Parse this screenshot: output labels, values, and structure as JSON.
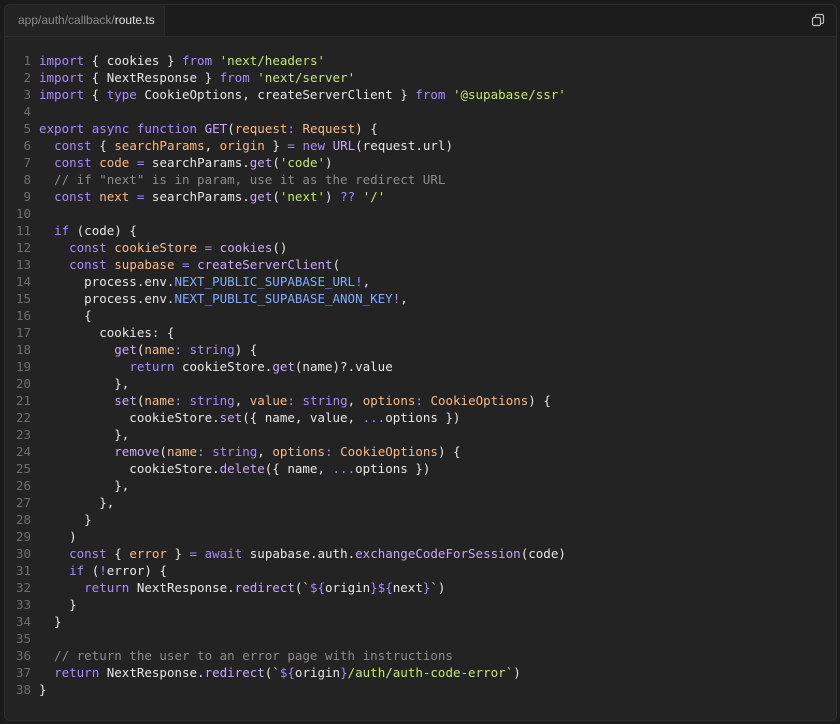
{
  "tab": {
    "path_prefix": "app/auth/callback/",
    "file_name": "route.ts"
  },
  "icons": {
    "copy": "copy-icon"
  },
  "colors": {
    "background": "#232323",
    "keyword": "#a78bfa",
    "string": "#c5e478",
    "comment": "#8b8b8b",
    "function": "#c7a8f7",
    "parameter": "#f8b886",
    "constant": "#82aaff",
    "line_number": "#6e6e6e"
  },
  "code_lines": [
    [
      [
        "keyword",
        "import"
      ],
      [
        "plain",
        " { cookies } "
      ],
      [
        "keyword",
        "from"
      ],
      [
        "plain",
        " "
      ],
      [
        "string",
        "'next/headers'"
      ]
    ],
    [
      [
        "keyword",
        "import"
      ],
      [
        "plain",
        " { NextResponse } "
      ],
      [
        "keyword",
        "from"
      ],
      [
        "plain",
        " "
      ],
      [
        "string",
        "'next/server'"
      ]
    ],
    [
      [
        "keyword",
        "import"
      ],
      [
        "plain",
        " { "
      ],
      [
        "keyword",
        "type"
      ],
      [
        "plain",
        " CookieOptions, createServerClient } "
      ],
      [
        "keyword",
        "from"
      ],
      [
        "plain",
        " "
      ],
      [
        "string",
        "'@supabase/ssr'"
      ]
    ],
    [],
    [
      [
        "keyword",
        "export"
      ],
      [
        "plain",
        " "
      ],
      [
        "keyword",
        "async"
      ],
      [
        "plain",
        " "
      ],
      [
        "keyword",
        "function"
      ],
      [
        "plain",
        " "
      ],
      [
        "func",
        "GET"
      ],
      [
        "plain",
        "("
      ],
      [
        "param",
        "request"
      ],
      [
        "keyword",
        ":"
      ],
      [
        "plain",
        " "
      ],
      [
        "type",
        "Request"
      ],
      [
        "plain",
        ") {"
      ]
    ],
    [
      [
        "plain",
        "  "
      ],
      [
        "keyword",
        "const"
      ],
      [
        "plain",
        " { "
      ],
      [
        "param",
        "searchParams"
      ],
      [
        "plain",
        ", "
      ],
      [
        "param",
        "origin"
      ],
      [
        "plain",
        " } "
      ],
      [
        "keyword",
        "="
      ],
      [
        "plain",
        " "
      ],
      [
        "keyword",
        "new"
      ],
      [
        "plain",
        " "
      ],
      [
        "func",
        "URL"
      ],
      [
        "plain",
        "(request.url)"
      ]
    ],
    [
      [
        "plain",
        "  "
      ],
      [
        "keyword",
        "const"
      ],
      [
        "plain",
        " "
      ],
      [
        "param",
        "code"
      ],
      [
        "plain",
        " "
      ],
      [
        "keyword",
        "="
      ],
      [
        "plain",
        " searchParams."
      ],
      [
        "func",
        "get"
      ],
      [
        "plain",
        "("
      ],
      [
        "string",
        "'code'"
      ],
      [
        "plain",
        ")"
      ]
    ],
    [
      [
        "comment",
        "  // if \"next\" is in param, use it as the redirect URL"
      ]
    ],
    [
      [
        "plain",
        "  "
      ],
      [
        "keyword",
        "const"
      ],
      [
        "plain",
        " "
      ],
      [
        "param",
        "next"
      ],
      [
        "plain",
        " "
      ],
      [
        "keyword",
        "="
      ],
      [
        "plain",
        " searchParams."
      ],
      [
        "func",
        "get"
      ],
      [
        "plain",
        "("
      ],
      [
        "string",
        "'next'"
      ],
      [
        "plain",
        ") "
      ],
      [
        "keyword",
        "??"
      ],
      [
        "plain",
        " "
      ],
      [
        "string",
        "'/'"
      ]
    ],
    [],
    [
      [
        "plain",
        "  "
      ],
      [
        "keyword",
        "if"
      ],
      [
        "plain",
        " (code) {"
      ]
    ],
    [
      [
        "plain",
        "    "
      ],
      [
        "keyword",
        "const"
      ],
      [
        "plain",
        " "
      ],
      [
        "param",
        "cookieStore"
      ],
      [
        "plain",
        " "
      ],
      [
        "keyword",
        "="
      ],
      [
        "plain",
        " "
      ],
      [
        "func",
        "cookies"
      ],
      [
        "plain",
        "()"
      ]
    ],
    [
      [
        "plain",
        "    "
      ],
      [
        "keyword",
        "const"
      ],
      [
        "plain",
        " "
      ],
      [
        "param",
        "supabase"
      ],
      [
        "plain",
        " "
      ],
      [
        "keyword",
        "="
      ],
      [
        "plain",
        " "
      ],
      [
        "func",
        "createServerClient"
      ],
      [
        "plain",
        "("
      ]
    ],
    [
      [
        "plain",
        "      process.env."
      ],
      [
        "const",
        "NEXT_PUBLIC_SUPABASE_URL"
      ],
      [
        "keyword",
        "!"
      ],
      [
        "plain",
        ","
      ]
    ],
    [
      [
        "plain",
        "      process.env."
      ],
      [
        "const",
        "NEXT_PUBLIC_SUPABASE_ANON_KEY"
      ],
      [
        "keyword",
        "!"
      ],
      [
        "plain",
        ","
      ]
    ],
    [
      [
        "plain",
        "      {"
      ]
    ],
    [
      [
        "plain",
        "        cookies: {"
      ]
    ],
    [
      [
        "plain",
        "          "
      ],
      [
        "func",
        "get"
      ],
      [
        "plain",
        "("
      ],
      [
        "param",
        "name"
      ],
      [
        "keyword",
        ":"
      ],
      [
        "plain",
        " "
      ],
      [
        "keyword",
        "string"
      ],
      [
        "plain",
        ") {"
      ]
    ],
    [
      [
        "plain",
        "            "
      ],
      [
        "keyword",
        "return"
      ],
      [
        "plain",
        " cookieStore."
      ],
      [
        "func",
        "get"
      ],
      [
        "plain",
        "(name)?.value"
      ]
    ],
    [
      [
        "plain",
        "          },"
      ]
    ],
    [
      [
        "plain",
        "          "
      ],
      [
        "func",
        "set"
      ],
      [
        "plain",
        "("
      ],
      [
        "param",
        "name"
      ],
      [
        "keyword",
        ":"
      ],
      [
        "plain",
        " "
      ],
      [
        "keyword",
        "string"
      ],
      [
        "plain",
        ", "
      ],
      [
        "param",
        "value"
      ],
      [
        "keyword",
        ":"
      ],
      [
        "plain",
        " "
      ],
      [
        "keyword",
        "string"
      ],
      [
        "plain",
        ", "
      ],
      [
        "param",
        "options"
      ],
      [
        "keyword",
        ":"
      ],
      [
        "plain",
        " "
      ],
      [
        "type",
        "CookieOptions"
      ],
      [
        "plain",
        ") {"
      ]
    ],
    [
      [
        "plain",
        "            cookieStore."
      ],
      [
        "func",
        "set"
      ],
      [
        "plain",
        "({ name, value, "
      ],
      [
        "keyword",
        "..."
      ],
      [
        "plain",
        "options })"
      ]
    ],
    [
      [
        "plain",
        "          },"
      ]
    ],
    [
      [
        "plain",
        "          "
      ],
      [
        "func",
        "remove"
      ],
      [
        "plain",
        "("
      ],
      [
        "param",
        "name"
      ],
      [
        "keyword",
        ":"
      ],
      [
        "plain",
        " "
      ],
      [
        "keyword",
        "string"
      ],
      [
        "plain",
        ", "
      ],
      [
        "param",
        "options"
      ],
      [
        "keyword",
        ":"
      ],
      [
        "plain",
        " "
      ],
      [
        "type",
        "CookieOptions"
      ],
      [
        "plain",
        ") {"
      ]
    ],
    [
      [
        "plain",
        "            cookieStore."
      ],
      [
        "func",
        "delete"
      ],
      [
        "plain",
        "({ name, "
      ],
      [
        "keyword",
        "..."
      ],
      [
        "plain",
        "options })"
      ]
    ],
    [
      [
        "plain",
        "          },"
      ]
    ],
    [
      [
        "plain",
        "        },"
      ]
    ],
    [
      [
        "plain",
        "      }"
      ]
    ],
    [
      [
        "plain",
        "    )"
      ]
    ],
    [
      [
        "plain",
        "    "
      ],
      [
        "keyword",
        "const"
      ],
      [
        "plain",
        " { "
      ],
      [
        "param",
        "error"
      ],
      [
        "plain",
        " } "
      ],
      [
        "keyword",
        "="
      ],
      [
        "plain",
        " "
      ],
      [
        "keyword",
        "await"
      ],
      [
        "plain",
        " supabase.auth."
      ],
      [
        "func",
        "exchangeCodeForSession"
      ],
      [
        "plain",
        "(code)"
      ]
    ],
    [
      [
        "plain",
        "    "
      ],
      [
        "keyword",
        "if"
      ],
      [
        "plain",
        " ("
      ],
      [
        "keyword",
        "!"
      ],
      [
        "plain",
        "error) {"
      ]
    ],
    [
      [
        "plain",
        "      "
      ],
      [
        "keyword",
        "return"
      ],
      [
        "plain",
        " NextResponse."
      ],
      [
        "func",
        "redirect"
      ],
      [
        "plain",
        "("
      ],
      [
        "string",
        "`"
      ],
      [
        "keyword",
        "${"
      ],
      [
        "plain",
        "origin"
      ],
      [
        "keyword",
        "}${"
      ],
      [
        "plain",
        "next"
      ],
      [
        "keyword",
        "}"
      ],
      [
        "string",
        "`"
      ],
      [
        "plain",
        ")"
      ]
    ],
    [
      [
        "plain",
        "    }"
      ]
    ],
    [
      [
        "plain",
        "  }"
      ]
    ],
    [],
    [
      [
        "comment",
        "  // return the user to an error page with instructions"
      ]
    ],
    [
      [
        "plain",
        "  "
      ],
      [
        "keyword",
        "return"
      ],
      [
        "plain",
        " NextResponse."
      ],
      [
        "func",
        "redirect"
      ],
      [
        "plain",
        "("
      ],
      [
        "string",
        "`"
      ],
      [
        "keyword",
        "${"
      ],
      [
        "plain",
        "origin"
      ],
      [
        "keyword",
        "}"
      ],
      [
        "string",
        "/auth/auth-code-error`"
      ],
      [
        "plain",
        ")"
      ]
    ],
    [
      [
        "plain",
        "}"
      ]
    ]
  ]
}
